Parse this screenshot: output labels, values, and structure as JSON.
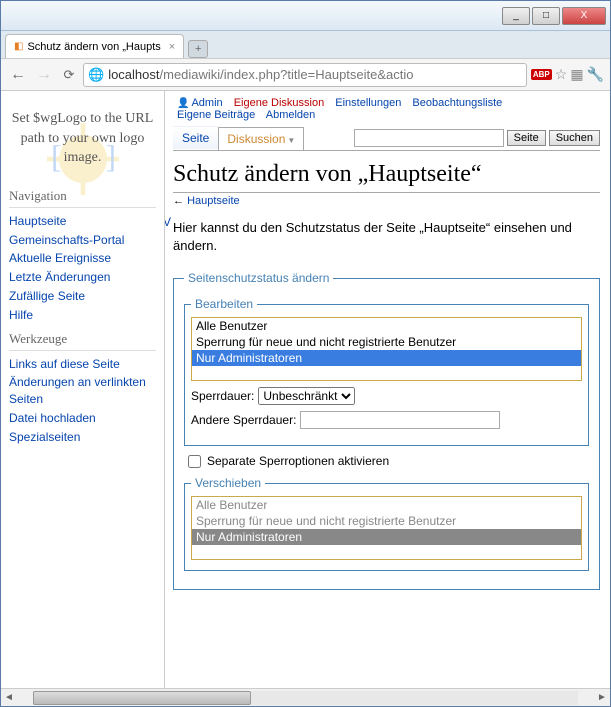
{
  "browser": {
    "tab_title": "Schutz ändern von „Haupts",
    "url_host": "localhost",
    "url_path": "/mediawiki/index.php?title=Hauptseite&actio",
    "btn_min": "_",
    "btn_max": "□",
    "btn_close": "X"
  },
  "logo_text": "Set $wgLogo to the URL path to your own logo image.",
  "left_tabs_trunc": "V",
  "user_links": {
    "admin": "Admin",
    "talk": "Eigene Diskussion",
    "prefs": "Einstellungen",
    "watch": "Beobachtungsliste",
    "contribs": "Eigene Beiträge",
    "logout": "Abmelden"
  },
  "page_tabs": {
    "page": "Seite",
    "discussion": "Diskussion"
  },
  "search_buttons": {
    "go": "Seite",
    "search": "Suchen"
  },
  "heading": "Schutz ändern von „Hauptseite“",
  "backlink_arrow": "←",
  "backlink_text": "Hauptseite",
  "intro": "Hier kannst du den Schutzstatus der Seite „Hauptseite“ einsehen und ändern.",
  "nav": {
    "title": "Navigation",
    "items": [
      "Hauptseite",
      "Gemeinschafts-Portal",
      "Aktuelle Ereignisse",
      "Letzte Änderungen",
      "Zufällige Seite",
      "Hilfe"
    ]
  },
  "tools": {
    "title": "Werkzeuge",
    "items": [
      "Links auf diese Seite",
      "Änderungen an verlinkten Seiten",
      "Datei hochladen",
      "Spezialseiten"
    ]
  },
  "protect": {
    "fs_title": "Seitenschutzstatus ändern",
    "edit_title": "Bearbeiten",
    "options": [
      "Alle Benutzer",
      "Sperrung für neue und nicht registrierte Benutzer",
      "Nur Administratoren"
    ],
    "selected_edit": 2,
    "expiry_label": "Sperrdauer:",
    "expiry_value": "Unbeschränkt",
    "other_label": "Andere Sperrdauer:",
    "separate_label": "Separate Sperroptionen aktivieren",
    "move_title": "Verschieben",
    "selected_move": 2
  }
}
